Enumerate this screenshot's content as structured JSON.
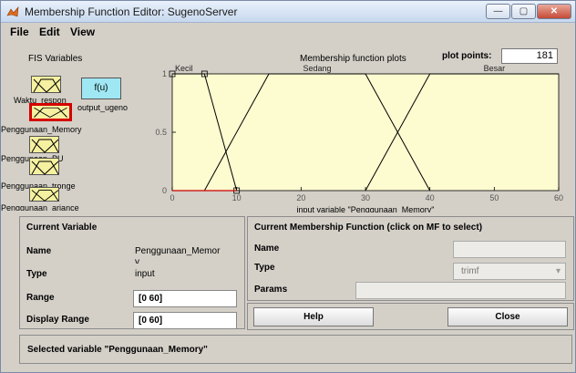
{
  "window": {
    "title": "Membership Function Editor: SugenoServer",
    "minimize_label": "—",
    "maximize_label": "▢",
    "close_label": "✕"
  },
  "menu": [
    "File",
    "Edit",
    "View"
  ],
  "fis": {
    "label": "FIS Variables",
    "inputs": [
      "Waktu_respon",
      "Penggunaan_Memory",
      "Penggunaan_PU",
      "Penggunaan_tronge",
      "Penggunaan_ariance"
    ],
    "output_box_label": "f(u)",
    "output_name": "output_ugeno"
  },
  "plot": {
    "title": "Membership function plots",
    "points_label": "plot points:",
    "points_value": "181"
  },
  "chart_data": {
    "type": "line",
    "xlabel": "input variable \"Penggunaan_Memory\"",
    "xlim": [
      0,
      60
    ],
    "ylim": [
      0,
      1
    ],
    "xticks": [
      "0",
      "10",
      "20",
      "30",
      "40",
      "50",
      "60"
    ],
    "yticks": [
      "0",
      "0.5",
      "1"
    ],
    "series": [
      {
        "name": "Kecil",
        "shape": "trimf",
        "points": [
          [
            0,
            1
          ],
          [
            5,
            1
          ],
          [
            10,
            0
          ]
        ],
        "color": "#000000",
        "selected": true
      },
      {
        "name": "Sedang",
        "shape": "trapmf",
        "points": [
          [
            5,
            0
          ],
          [
            15,
            1
          ],
          [
            30,
            1
          ],
          [
            40,
            0
          ]
        ],
        "color": "#000000"
      },
      {
        "name": "Besar",
        "shape": "trapmf",
        "points": [
          [
            30,
            0
          ],
          [
            40,
            1
          ],
          [
            60,
            1
          ]
        ],
        "color": "#000000"
      }
    ],
    "selected_line_color": "#cc0000"
  },
  "current_variable": {
    "title": "Current Variable",
    "name_label": "Name",
    "name_value": "Penggunaan_Memor",
    "name_value_wrap": "y",
    "type_label": "Type",
    "type_value": "input",
    "range_label": "Range",
    "range_value": "[0 60]",
    "display_range_label": "Display Range",
    "display_range_value": "[0 60]"
  },
  "current_mf": {
    "title": "Current Membership Function (click on MF to select)",
    "name_label": "Name",
    "name_value": "",
    "type_label": "Type",
    "type_value": "trimf",
    "params_label": "Params",
    "params_value": ""
  },
  "buttons": {
    "help": "Help",
    "close": "Close"
  },
  "status": "Selected variable \"Penggunaan_Memory\""
}
